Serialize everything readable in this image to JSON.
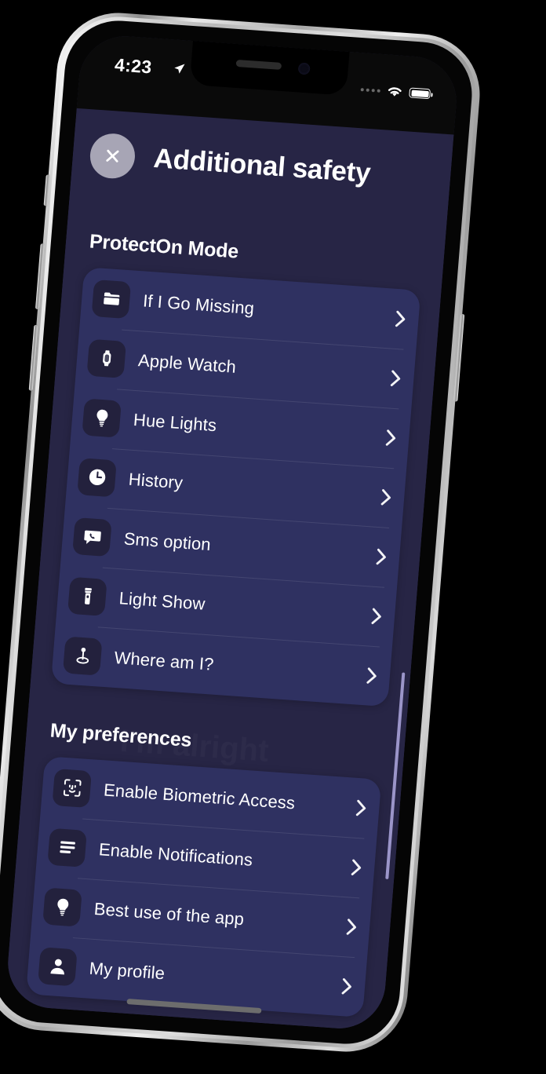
{
  "status_bar": {
    "time": "4:23",
    "location_icon": "location-arrow-icon",
    "signal_icon": "signal-dots-icon",
    "wifi_icon": "wifi-icon",
    "battery_icon": "battery-full-icon"
  },
  "header": {
    "close_label": "×",
    "close_icon": "close-x-icon",
    "title": "Additional safety"
  },
  "colors": {
    "page_background": "#262443",
    "card_background": "#2f3161",
    "icon_tile": "#23213d",
    "accent_text": "#ffffff",
    "close_button": "#a7a5b5",
    "scroll_indicator": "#9b95c9"
  },
  "ghost": {
    "line1": "I'm alright",
    "line2": "I'm alright"
  },
  "sections": [
    {
      "heading": "ProtectOn Mode",
      "items": [
        {
          "label": "If I Go Missing",
          "icon": "folder-icon",
          "chevron": "chevron-right-icon"
        },
        {
          "label": "Apple Watch",
          "icon": "apple-watch-icon",
          "chevron": "chevron-right-icon"
        },
        {
          "label": "Hue Lights",
          "icon": "lightbulb-icon",
          "chevron": "chevron-right-icon"
        },
        {
          "label": "History",
          "icon": "clock-icon",
          "chevron": "chevron-right-icon"
        },
        {
          "label": "Sms option",
          "icon": "sms-phone-icon",
          "chevron": "chevron-right-icon"
        },
        {
          "label": "Light Show",
          "icon": "flashlight-icon",
          "chevron": "chevron-right-icon"
        },
        {
          "label": "Where am I?",
          "icon": "location-pin-icon",
          "chevron": "chevron-right-icon"
        }
      ]
    },
    {
      "heading": "My preferences",
      "items": [
        {
          "label": "Enable Biometric Access",
          "icon": "face-id-icon",
          "chevron": "chevron-right-icon"
        },
        {
          "label": "Enable Notifications",
          "icon": "notification-lines-icon",
          "chevron": "chevron-right-icon"
        },
        {
          "label": "Best use of the app",
          "icon": "lightbulb-icon",
          "chevron": "chevron-right-icon"
        },
        {
          "label": "My profile",
          "icon": "person-icon",
          "chevron": "chevron-right-icon"
        }
      ]
    }
  ],
  "device": {
    "home_indicator": "home-indicator",
    "mute_switch": "mute-switch",
    "volume_up": "volume-up-button",
    "volume_down": "volume-down-button",
    "power": "power-button"
  }
}
